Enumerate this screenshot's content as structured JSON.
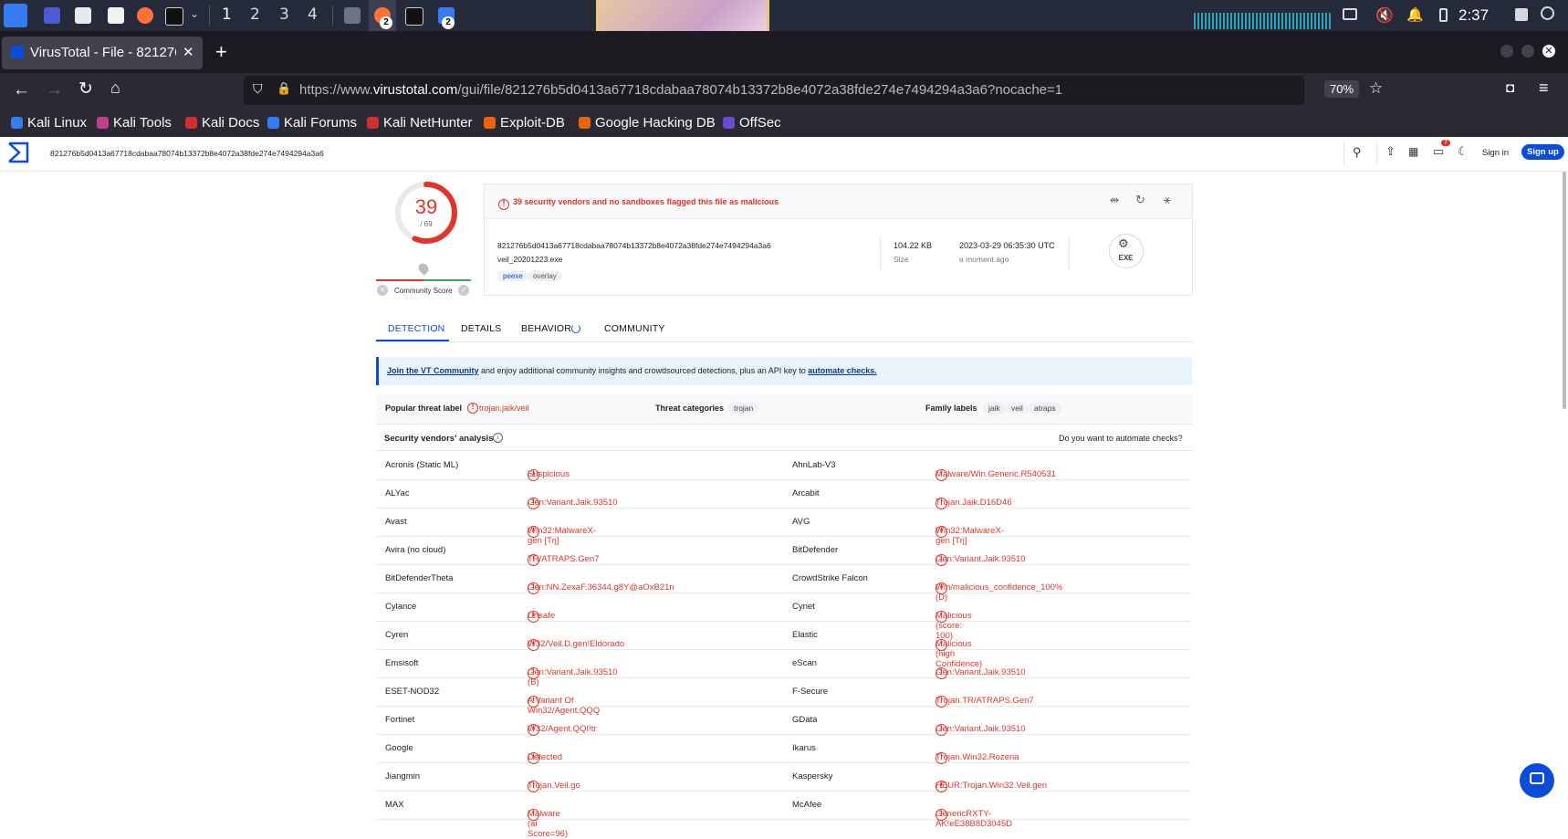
{
  "taskbar": {
    "workspaces": [
      "1",
      "2",
      "3",
      "4"
    ],
    "badge_app1": "2",
    "badge_app2": "2",
    "clock": "2:37"
  },
  "browser": {
    "tab_title": "VirusTotal - File - 821276b",
    "url_prefix": "https://www.",
    "url_domain": "virustotal.com",
    "url_path": "/gui/file/821276b5d0413a67718cdabaa78074b13372b8e4072a38fde274e7494294a3a6?nocache=1",
    "zoom": "70%",
    "bookmarks": [
      "Kali Linux",
      "Kali Tools",
      "Kali Docs",
      "Kali Forums",
      "Kali NetHunter",
      "Exploit-DB",
      "Google Hacking DB",
      "OffSec"
    ]
  },
  "vt": {
    "search_value": "821276b5d0413a67718cdabaa78074b13372b8e4072a38fde274e7494294a3a6",
    "notif_count": "7",
    "sign_in": "Sign in",
    "sign_up": "Sign up",
    "score": "39",
    "score_total": "/ 69",
    "community_label": "Community Score",
    "flag_message": "39 security vendors and no sandboxes flagged this file as malicious",
    "hash": "821276b5d0413a67718cdabaa78074b13372b8e4072a38fde274e7494294a3a6",
    "filename": "veil_20201223.exe",
    "tags": [
      "peexe",
      "overlay"
    ],
    "size_value": "104.22 KB",
    "size_label": "Size",
    "date_value": "2023-03-29 06:35:30 UTC",
    "date_label": "a moment ago",
    "filetype": "EXE",
    "tabs": [
      "DETECTION",
      "DETAILS",
      "BEHAVIOR",
      "COMMUNITY"
    ],
    "banner_link1": "Join the VT Community",
    "banner_text": " and enjoy additional community insights and crowdsourced detections, plus an API key to ",
    "banner_link2": "automate checks.",
    "popular_label": "Popular threat label",
    "popular_value": "trojan.jaik/veil",
    "categories_label": "Threat categories",
    "categories_tags": [
      "trojan"
    ],
    "family_label": "Family labels",
    "family_tags": [
      "jaik",
      "veil",
      "atraps"
    ],
    "vendors_title": "Security vendors' analysis",
    "automate_q": "Do you want to automate checks?",
    "rows": [
      {
        "v1": "Acronis (Static ML)",
        "r1": "Suspicious",
        "v2": "AhnLab-V3",
        "r2": "Malware/Win.Generic.R540531"
      },
      {
        "v1": "ALYac",
        "r1": "Gen:Variant.Jaik.93510",
        "v2": "Arcabit",
        "r2": "Trojan.Jaik.D16D46"
      },
      {
        "v1": "Avast",
        "r1": "Win32:MalwareX-gen [Trj]",
        "v2": "AVG",
        "r2": "Win32:MalwareX-gen [Trj]"
      },
      {
        "v1": "Avira (no cloud)",
        "r1": "TR/ATRAPS.Gen7",
        "v2": "BitDefender",
        "r2": "Gen:Variant.Jaik.93510"
      },
      {
        "v1": "BitDefenderTheta",
        "r1": "Gen:NN.ZexaF.36344.g8Y@aOxB21n",
        "v2": "CrowdStrike Falcon",
        "r2": "Win/malicious_confidence_100% (D)"
      },
      {
        "v1": "Cylance",
        "r1": "Unsafe",
        "v2": "Cynet",
        "r2": "Malicious (score: 100)"
      },
      {
        "v1": "Cyren",
        "r1": "W32/Veil.D.gen!Eldorado",
        "v2": "Elastic",
        "r2": "Malicious (high Confidence)"
      },
      {
        "v1": "Emsisoft",
        "r1": "Gen:Variant.Jaik.93510 (B)",
        "v2": "eScan",
        "r2": "Gen:Variant.Jaik.93510"
      },
      {
        "v1": "ESET-NOD32",
        "r1": "A Variant Of Win32/Agent.QQQ",
        "v2": "F-Secure",
        "r2": "Trojan.TR/ATRAPS.Gen7"
      },
      {
        "v1": "Fortinet",
        "r1": "W32/Agent.QQI!tr",
        "v2": "GData",
        "r2": "Gen:Variant.Jaik.93510"
      },
      {
        "v1": "Google",
        "r1": "Detected",
        "v2": "Ikarus",
        "r2": "Trojan.Win32.Rozena"
      },
      {
        "v1": "Jiangmin",
        "r1": "Trojan.Veil.go",
        "v2": "Kaspersky",
        "r2": "HEUR:Trojan.Win32.Veil.gen"
      },
      {
        "v1": "MAX",
        "r1": "Malware (ai Score=96)",
        "v2": "McAfee",
        "r2": "GenericRXTY-AK!eE38B8D3045D"
      }
    ]
  }
}
